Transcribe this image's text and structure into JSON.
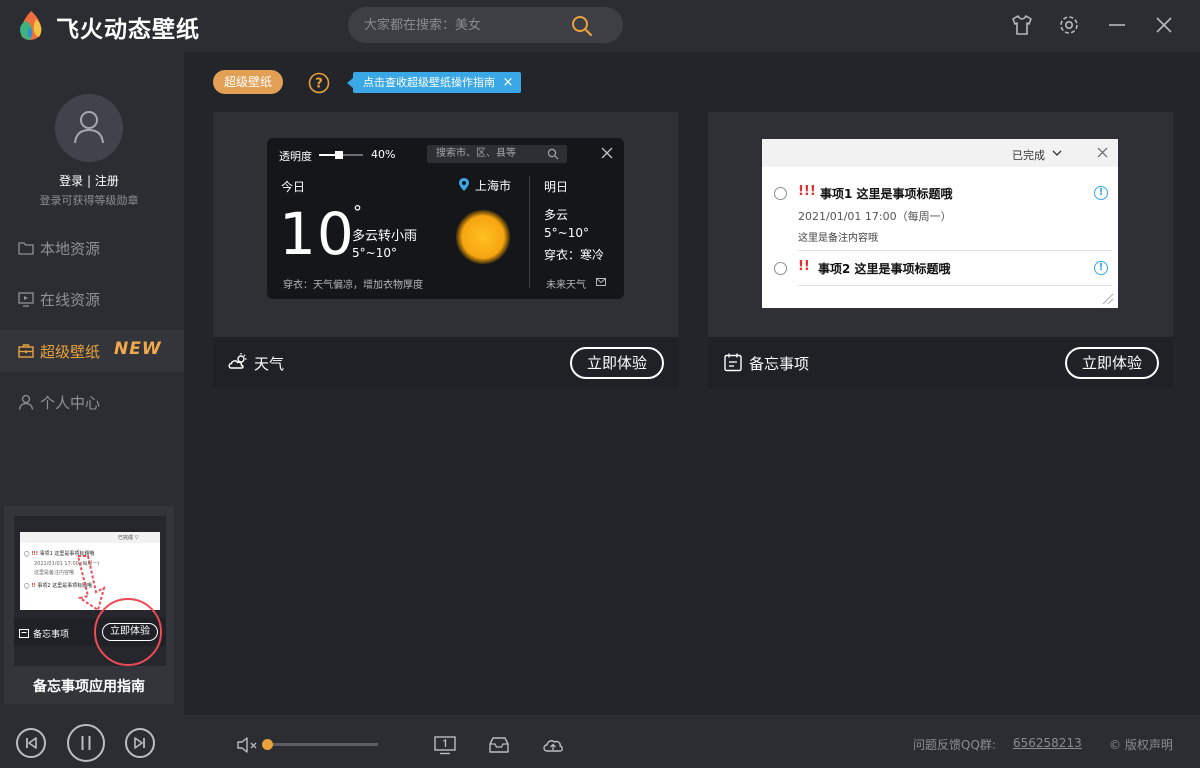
{
  "app": {
    "title": "飞火动态壁纸"
  },
  "search": {
    "placeholder": "大家都在搜索：美女"
  },
  "user": {
    "login_label": "登录 | 注册",
    "login_sub": "登录可获得等级勋章"
  },
  "sidebar": {
    "items": [
      {
        "label": "本地资源",
        "icon": "folder-icon",
        "active": false
      },
      {
        "label": "在线资源",
        "icon": "monitor-icon",
        "active": false
      },
      {
        "label": "超级壁纸",
        "icon": "briefcase-icon",
        "active": true,
        "badge": "NEW"
      },
      {
        "label": "个人中心",
        "icon": "person-icon",
        "active": false
      }
    ],
    "guide": {
      "title": "备忘事项应用指南",
      "mini_done": "已完成 ▽",
      "mini_item1": "事项1 这里是事项标题哦",
      "mini_date": "2021/01/01 17:00 (每周一)",
      "mini_note": "这里是备注内容哦",
      "mini_item2": "事项2 这里是事项标题哦",
      "mini_bar_label": "备忘事项",
      "mini_btn": "立即体验"
    }
  },
  "toolbar": {
    "tag": "超级壁纸",
    "help_symbol": "?",
    "tip": "点击查收超级壁纸操作指南",
    "tip_close": "×"
  },
  "weather_card": {
    "label": "天气",
    "button": "立即体验",
    "opacity_label": "透明度",
    "opacity_value": "40%",
    "opacity_fraction": 0.4,
    "search_placeholder": "搜索市、区、县等",
    "today_label": "今日",
    "temp": "10",
    "deg": "°",
    "condition": "多云转小雨",
    "range": "5°~10°",
    "city": "上海市",
    "tomorrow_label": "明日",
    "tomorrow_condition": "多云",
    "tomorrow_range": "5°~10°",
    "tomorrow_dress": "穿衣：寒冷",
    "advice": "穿衣：天气偏凉，增加衣物厚度",
    "future": "未来天气"
  },
  "memo_card": {
    "label": "备忘事项",
    "button": "立即体验",
    "done_label": "已完成",
    "items": [
      {
        "bang": "!!!",
        "title": "事项1 这里是事项标题哦",
        "date": "2021/01/01 17:00（每周一）",
        "note": "这里是备注内容哦"
      },
      {
        "bang": "!!",
        "title": "事项2 这里是事项标题哦"
      }
    ],
    "info_symbol": "!"
  },
  "bottom": {
    "volume_fraction": 0.04,
    "feedback": "问题反馈QQ群:",
    "qq": "656258213",
    "copyright": "© 版权声明"
  },
  "colors": {
    "accent": "#e9a23b",
    "tip": "#3aa7e6",
    "background": "#24252b",
    "panel": "#2c2d33"
  }
}
